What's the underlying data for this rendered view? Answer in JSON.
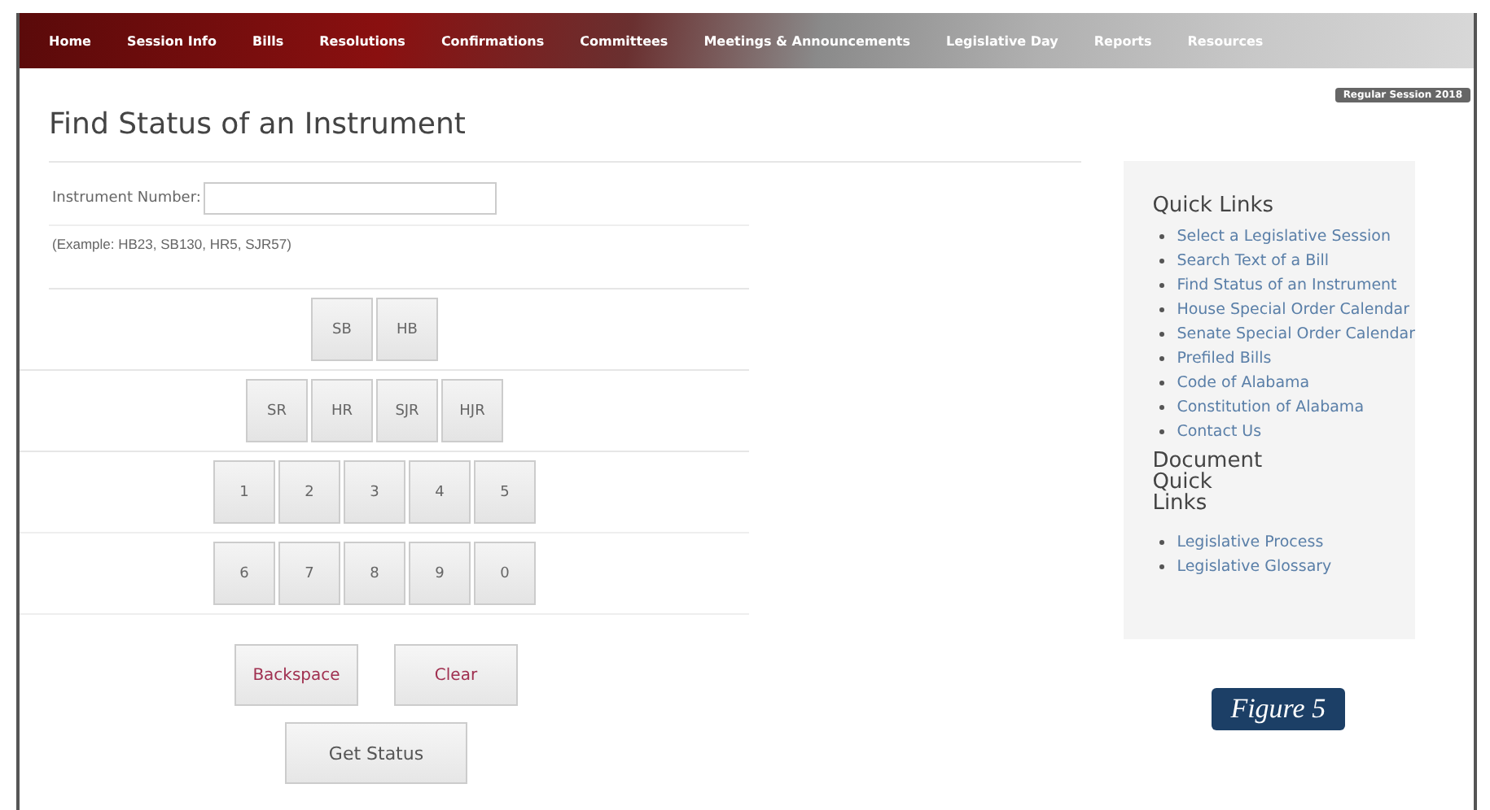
{
  "nav": [
    {
      "label": "Home"
    },
    {
      "label": "Session Info"
    },
    {
      "label": "Bills"
    },
    {
      "label": "Resolutions"
    },
    {
      "label": "Confirmations"
    },
    {
      "label": "Committees"
    },
    {
      "label": "Meetings & Announcements"
    },
    {
      "label": "Legislative Day"
    },
    {
      "label": "Reports"
    },
    {
      "label": "Resources"
    }
  ],
  "session_badge": "Regular Session 2018",
  "title": "Find Status of an Instrument",
  "instrument": {
    "label": "Instrument Number:",
    "hint": "(Example: HB23, SB130, HR5, SJR57)"
  },
  "key_rows": [
    [
      "SB",
      "HB"
    ],
    [
      "SR",
      "HR",
      "SJR",
      "HJR"
    ],
    [
      "1",
      "2",
      "3",
      "4",
      "5"
    ],
    [
      "6",
      "7",
      "8",
      "9",
      "0"
    ]
  ],
  "edit_buttons": [
    "Backspace",
    "Clear"
  ],
  "submit": "Get Status",
  "quick_links": {
    "title": "Quick Links",
    "items": [
      "Select a Legislative Session",
      "Search Text of a Bill",
      "Find Status of an Instrument",
      "House Special Order Calendar",
      "Senate Special Order Calendar",
      "Prefiled Bills",
      "Code of Alabama",
      "Constitution of Alabama",
      "Contact Us"
    ]
  },
  "document_links": {
    "title_lines": [
      "Document",
      "Quick",
      "Links"
    ],
    "items": [
      "Legislative Process",
      "Legislative Glossary"
    ]
  },
  "figure_label": "Figure 5"
}
